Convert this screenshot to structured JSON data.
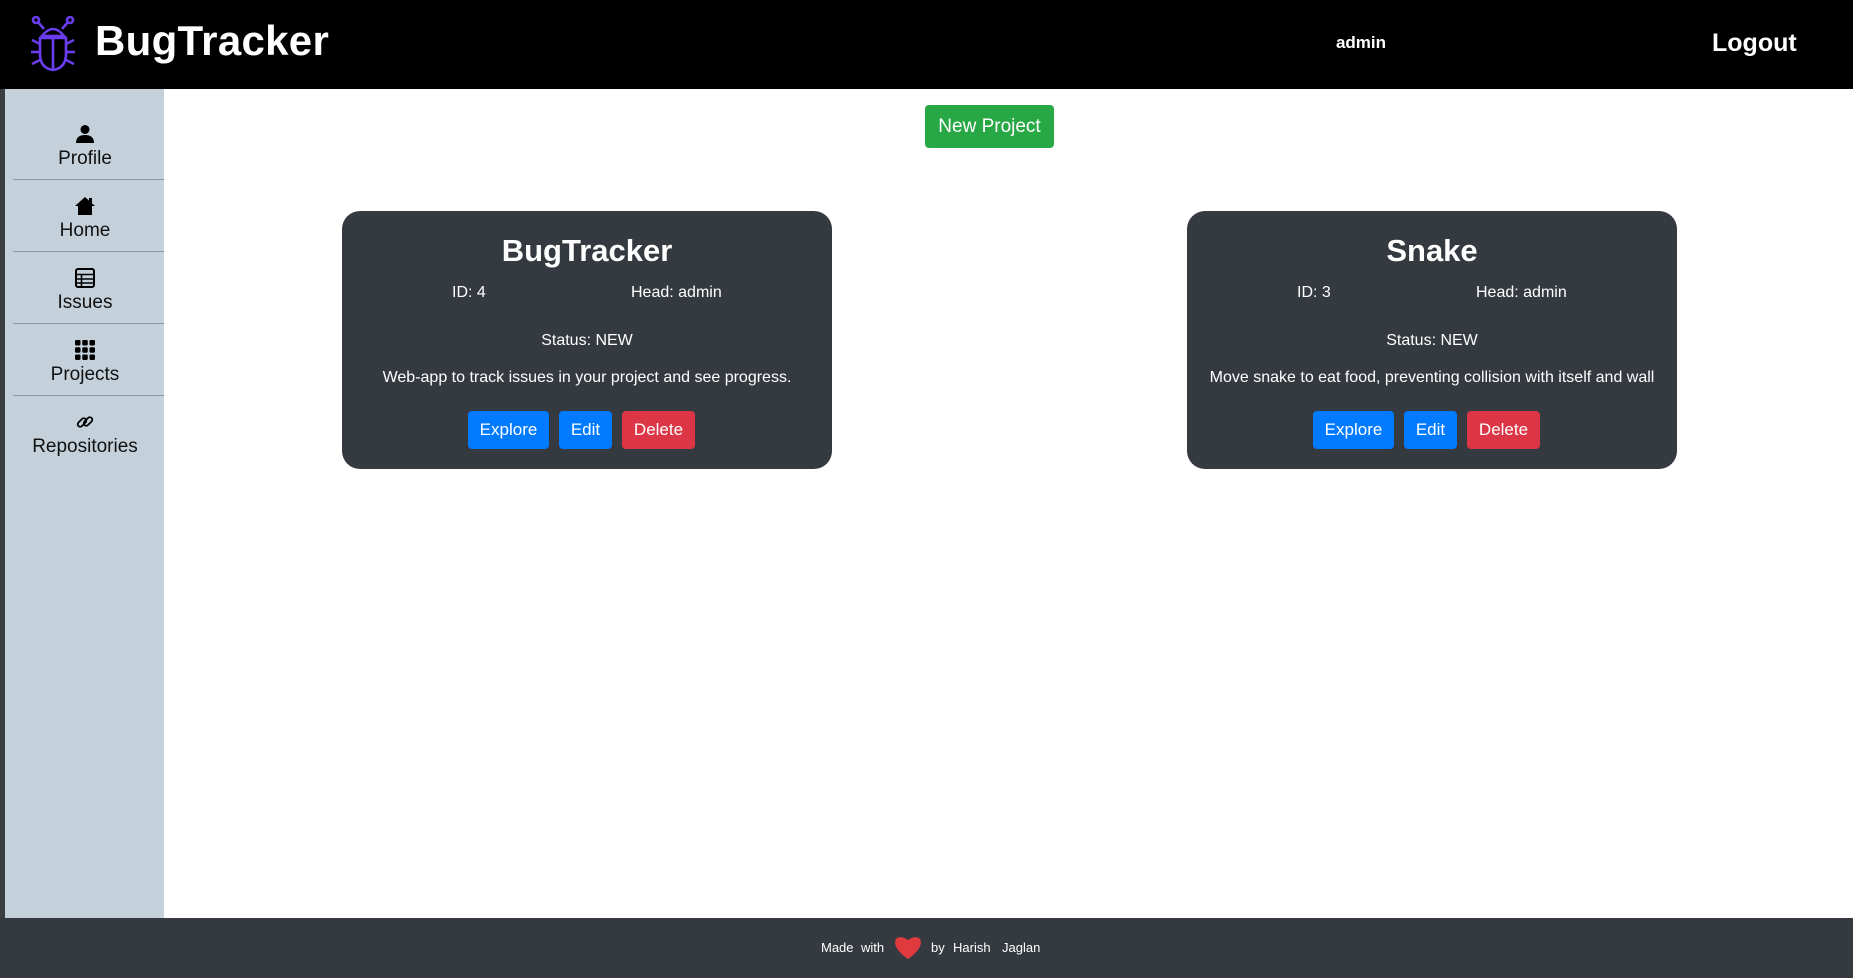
{
  "app": {
    "brand": "BugTracker",
    "user": "admin",
    "logout_label": "Logout"
  },
  "sidebar": {
    "items": [
      {
        "label": "Profile",
        "icon": "person-icon"
      },
      {
        "label": "Home",
        "icon": "house-icon"
      },
      {
        "label": "Issues",
        "icon": "table-icon"
      },
      {
        "label": "Projects",
        "icon": "grid-icon"
      },
      {
        "label": "Repositories",
        "icon": "link-icon"
      }
    ]
  },
  "main": {
    "new_project_label": "New Project",
    "projects": [
      {
        "title": "BugTracker",
        "id": "ID: 4",
        "head": "Head: admin",
        "status": "Status: NEW",
        "description": "Web-app to track issues in your project and see progress.",
        "explore_label": "Explore",
        "edit_label": "Edit",
        "delete_label": "Delete"
      },
      {
        "title": "Snake",
        "id": "ID: 3",
        "head": "Head: admin",
        "status": "Status: NEW",
        "description": "Move snake to eat food, preventing collision with itself and wall",
        "explore_label": "Explore",
        "edit_label": "Edit",
        "delete_label": "Delete"
      }
    ]
  },
  "footer": {
    "made": "Made",
    "with": "with",
    "by": "by",
    "first_name": "Harish",
    "last_name": "Jaglan",
    "heart_icon": "heart-icon"
  },
  "colors": {
    "topbar": "#000000",
    "sidebar": "#c5d1da",
    "card": "#343a40",
    "success": "#28a745",
    "primary": "#007bff",
    "danger": "#dc3545",
    "heart": "#e0393e",
    "logo": "#6a3df0"
  }
}
